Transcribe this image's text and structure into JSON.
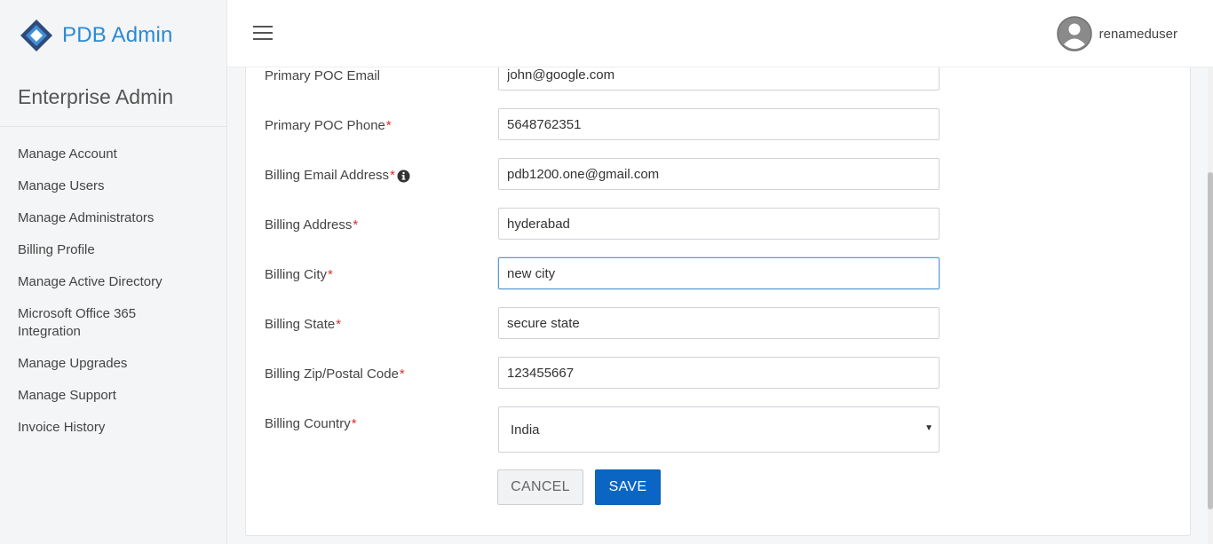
{
  "brand": {
    "name": "PDB Admin"
  },
  "sidebar": {
    "title": "Enterprise Admin",
    "items": [
      {
        "label": "Manage Account"
      },
      {
        "label": "Manage Users"
      },
      {
        "label": "Manage Administrators"
      },
      {
        "label": "Billing Profile"
      },
      {
        "label": "Manage Active Directory"
      },
      {
        "label": "Microsoft Office 365 Integration"
      },
      {
        "label": "Manage Upgrades"
      },
      {
        "label": "Manage Support"
      },
      {
        "label": "Invoice History"
      }
    ]
  },
  "header": {
    "username": "renameduser"
  },
  "form": {
    "fields": [
      {
        "label": "Primary POC Email",
        "value": "john@google.com"
      },
      {
        "label": "Primary POC Phone",
        "value": "5648762351"
      },
      {
        "label": "Billing Email Address",
        "value": "pdb1200.one@gmail.com"
      },
      {
        "label": "Billing Address",
        "value": "hyderabad"
      },
      {
        "label": "Billing City",
        "value": "new city"
      },
      {
        "label": "Billing State",
        "value": "secure state"
      },
      {
        "label": "Billing Zip/Postal Code",
        "value": "123455667"
      },
      {
        "label": "Billing Country",
        "value": "India"
      }
    ],
    "required_marker": "*",
    "cancel_label": "CANCEL",
    "save_label": "SAVE"
  },
  "colors": {
    "brand": "#2b8ad6",
    "primary": "#0b66c3",
    "required": "#d9302b"
  },
  "icons": {
    "logo": "diamond-logo-icon",
    "menu": "hamburger-icon",
    "user": "user-avatar-icon",
    "info": "info-icon",
    "dropdown": "caret-down-icon"
  }
}
